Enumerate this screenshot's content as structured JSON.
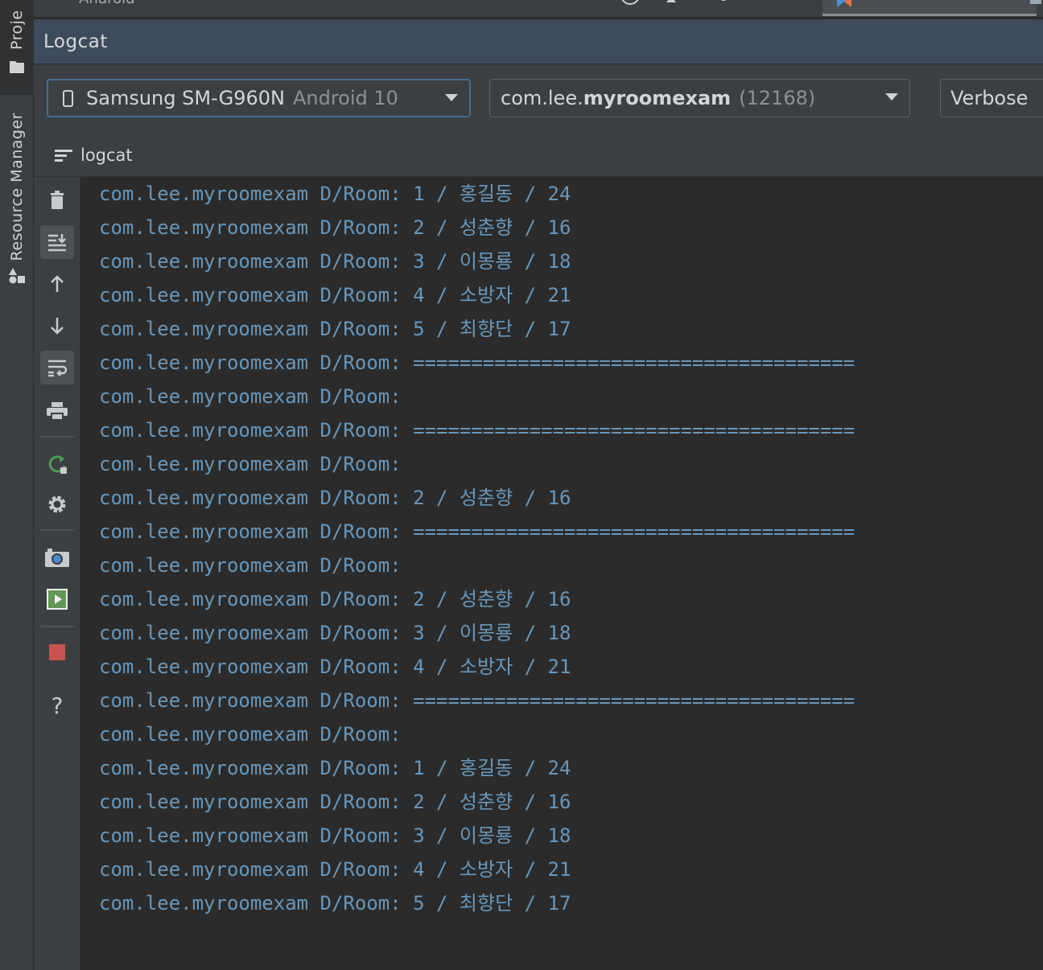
{
  "side_strip": {
    "project_label": "Proje",
    "resource_manager_label": "Resource Manager"
  },
  "topbar": {
    "cut_label": "Android"
  },
  "logcat_panel": {
    "title": "Logcat"
  },
  "selectors": {
    "device": {
      "name": "Samsung SM-G960N",
      "os": "Android 10"
    },
    "process": {
      "prefix": "com.lee.",
      "name": "myroomexam",
      "pid": "(12168)"
    },
    "log_level": "Verbose"
  },
  "subtab": {
    "label": "logcat"
  },
  "toolbar": {
    "icons": [
      "trash-icon",
      "scroll-to-end-icon",
      "up-arrow-icon",
      "down-arrow-icon",
      "soft-wrap-icon",
      "print-icon",
      "restart-icon",
      "settings-icon",
      "screenshot-icon",
      "screen-record-icon",
      "stop-icon",
      "help-icon"
    ]
  },
  "log_lines": [
    "com.lee.myroomexam D/Room: 1 / 홍길동 / 24",
    "com.lee.myroomexam D/Room: 2 / 성춘향 / 16",
    "com.lee.myroomexam D/Room: 3 / 이몽룡 / 18",
    "com.lee.myroomexam D/Room: 4 / 소방자 / 21",
    "com.lee.myroomexam D/Room: 5 / 최향단 / 17",
    "com.lee.myroomexam D/Room: ======================================",
    "com.lee.myroomexam D/Room:",
    "com.lee.myroomexam D/Room: ======================================",
    "com.lee.myroomexam D/Room:",
    "com.lee.myroomexam D/Room: 2 / 성춘향 / 16",
    "com.lee.myroomexam D/Room: ======================================",
    "com.lee.myroomexam D/Room:",
    "com.lee.myroomexam D/Room: 2 / 성춘향 / 16",
    "com.lee.myroomexam D/Room: 3 / 이몽룡 / 18",
    "com.lee.myroomexam D/Room: 4 / 소방자 / 21",
    "com.lee.myroomexam D/Room: ======================================",
    "com.lee.myroomexam D/Room:",
    "com.lee.myroomexam D/Room: 1 / 홍길동 / 24",
    "com.lee.myroomexam D/Room: 2 / 성춘향 / 16",
    "com.lee.myroomexam D/Room: 3 / 이몽룡 / 18",
    "com.lee.myroomexam D/Room: 4 / 소방자 / 21",
    "com.lee.myroomexam D/Room: 5 / 최향단 / 17"
  ],
  "colors": {
    "log_text": "#6897bb",
    "panel_header": "#3d4b5c",
    "background": "#2b2b2b",
    "toolbar": "#3c3f41",
    "stop_red": "#c75450",
    "record_green": "#629755",
    "restart_green": "#499c54"
  }
}
